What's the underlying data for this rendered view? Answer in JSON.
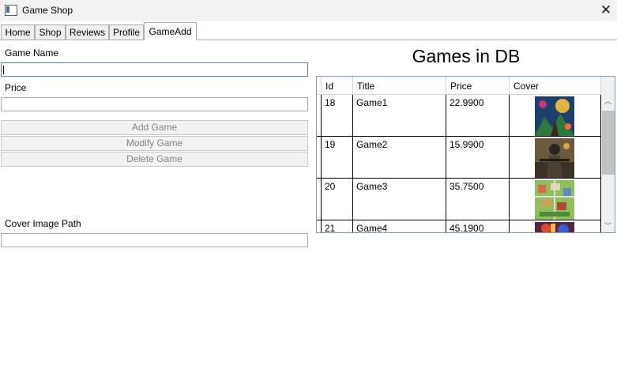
{
  "window": {
    "title": "Game Shop",
    "close_glyph": "✕"
  },
  "tabs": [
    {
      "label": "Home",
      "selected": false
    },
    {
      "label": "Shop",
      "selected": false
    },
    {
      "label": "Reviews",
      "selected": false
    },
    {
      "label": "Profile",
      "selected": false
    },
    {
      "label": "GameAdd",
      "selected": true
    }
  ],
  "form": {
    "game_name_label": "Game Name",
    "game_name_value": "",
    "price_label": "Price",
    "price_value": "",
    "add_button": "Add Game",
    "modify_button": "Modify Game",
    "delete_button": "Delete Game",
    "cover_path_label": "Cover Image Path",
    "cover_path_value": ""
  },
  "grid": {
    "heading": "Games in DB",
    "columns": [
      "Id",
      "Title",
      "Price",
      "Cover"
    ],
    "rows": [
      {
        "id": "18",
        "title": "Game1",
        "price": "22.9900",
        "cover": "cover-game1-fantasy-art"
      },
      {
        "id": "19",
        "title": "Game2",
        "price": "15.9900",
        "cover": "cover-game2-soldier-art"
      },
      {
        "id": "20",
        "title": "Game3",
        "price": "35.7500",
        "cover": "cover-game3-city-builder-art"
      },
      {
        "id": "21",
        "title": "Game4",
        "price": "45.1900",
        "cover": "cover-game4-art"
      }
    ]
  },
  "colors": {
    "focus_border": "#4f7fa8",
    "disabled_text": "#838383",
    "grid_border": "#7f9db9"
  }
}
